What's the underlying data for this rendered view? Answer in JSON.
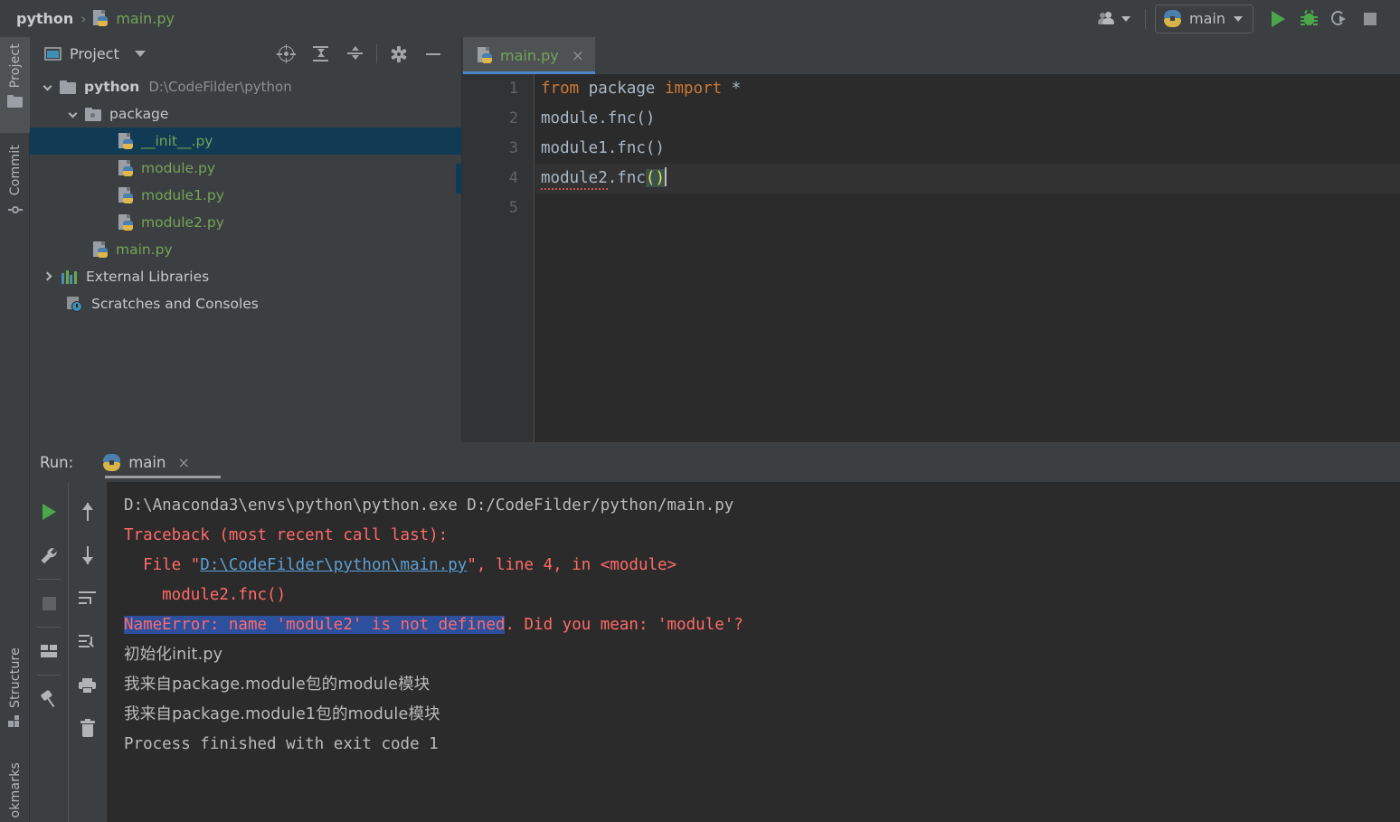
{
  "app": {
    "breadcrumb": {
      "project": "python",
      "separator": "›",
      "file": "main.py",
      "file_icon": "python-file-icon"
    },
    "toolbar": {
      "people_icon": "people-icon",
      "run_config": {
        "name": "main",
        "icon": "python-icon",
        "caret": "caret-down-icon"
      },
      "run_button": "run-icon",
      "debug_button": "debug-icon",
      "coverage_button": "run-with-coverage-icon",
      "stop_button": "stop-icon"
    }
  },
  "left_strip": {
    "tabs": [
      {
        "label": "Project",
        "icon": "folder-icon",
        "active": true
      },
      {
        "label": "Commit",
        "icon": "commit-icon",
        "active": false
      },
      {
        "label": "Structure",
        "icon": "structure-icon",
        "active": false
      },
      {
        "label": "okmarks",
        "icon": "bookmarks-icon",
        "active": false
      }
    ]
  },
  "project_panel": {
    "title": "Project",
    "title_icon": "project-window-icon",
    "dropdown_icon": "chevron-down-icon",
    "tools": [
      {
        "name": "select-opened-file-icon"
      },
      {
        "name": "expand-all-icon"
      },
      {
        "name": "collapse-all-icon"
      },
      {
        "name": "settings-gear-icon"
      },
      {
        "name": "hide-panel-icon"
      }
    ],
    "tree": [
      {
        "indent": 0,
        "arrow": "down",
        "icon": "folder-icon",
        "label": "python",
        "bold": true,
        "path": "D:\\CodeFilder\\python",
        "selected": false
      },
      {
        "indent": 1,
        "arrow": "down",
        "icon": "package-folder-icon",
        "label": "package",
        "bold": false,
        "path": "",
        "selected": false
      },
      {
        "indent": 2,
        "arrow": "none",
        "icon": "python-file-icon",
        "label": "__init__.py",
        "bold": false,
        "path": "",
        "selected": true
      },
      {
        "indent": 2,
        "arrow": "none",
        "icon": "python-file-icon",
        "label": "module.py",
        "bold": false,
        "path": "",
        "selected": false
      },
      {
        "indent": 2,
        "arrow": "none",
        "icon": "python-file-icon",
        "label": "module1.py",
        "bold": false,
        "path": "",
        "selected": false
      },
      {
        "indent": 2,
        "arrow": "none",
        "icon": "python-file-icon",
        "label": "module2.py",
        "bold": false,
        "path": "",
        "selected": false
      },
      {
        "indent": 1,
        "arrow": "none",
        "icon": "python-file-icon",
        "label": "main.py",
        "bold": false,
        "path": "",
        "selected": false
      },
      {
        "indent": 0,
        "arrow": "right",
        "icon": "libraries-icon",
        "label": "External Libraries",
        "bold": false,
        "path": "",
        "selected": false
      },
      {
        "indent": 0,
        "arrow": "none",
        "icon": "scratches-icon",
        "label": "Scratches and Consoles",
        "bold": false,
        "path": "",
        "selected": false
      }
    ]
  },
  "editor": {
    "tab": {
      "label": "main.py",
      "icon": "python-file-icon",
      "close": "×",
      "active": true
    },
    "line_numbers": [
      "1",
      "2",
      "3",
      "4",
      "5"
    ],
    "lines": [
      {
        "n": 1,
        "text": "from package import *"
      },
      {
        "n": 2,
        "text": "module.fnc()"
      },
      {
        "n": 3,
        "text": "module1.fnc()"
      },
      {
        "n": 4,
        "text": "module2.fnc()",
        "current": true,
        "error": true
      },
      {
        "n": 5,
        "text": ""
      }
    ],
    "tokens": {
      "kw_from": "from",
      "mod_package": " package ",
      "kw_import": "import",
      "star": " *",
      "l2_a": "module.fnc()",
      "l3_a": "module1.fnc()",
      "l4_a": "module2",
      "l4_b": ".fnc",
      "l4_c": "()"
    }
  },
  "run_panel": {
    "label": "Run:",
    "tab": {
      "name": "main",
      "icon": "python-icon",
      "close": "×"
    },
    "tools_left": [
      {
        "name": "rerun-icon"
      },
      {
        "name": "settings-wrench-icon"
      },
      {
        "name": "stop-icon"
      },
      {
        "name": "layout-icon"
      },
      {
        "name": "pin-tab-icon"
      }
    ],
    "tools_right": [
      {
        "name": "up-arrow-icon"
      },
      {
        "name": "down-arrow-icon"
      },
      {
        "name": "soft-wrap-icon"
      },
      {
        "name": "scroll-to-end-icon"
      },
      {
        "name": "print-icon"
      },
      {
        "name": "clear-all-icon"
      }
    ],
    "console": {
      "l1": "D:\\Anaconda3\\envs\\python\\python.exe D:/CodeFilder/python/main.py",
      "l2": "Traceback (most recent call last):",
      "l3_pre": "  File \"",
      "l3_link": "D:\\CodeFilder\\python\\main.py",
      "l3_post": "\", line 4, in <module>",
      "l4": "    module2.fnc()",
      "l5_hl": "NameError: name 'module2' is not defined",
      "l5_rest": ". Did you mean: 'module'?",
      "l6": "初始化init.py",
      "l7": "我来自package.module包的module模块",
      "l8": "我来自package.module1包的module模块",
      "l9": "",
      "l10": "Process finished with exit code 1"
    }
  },
  "colors": {
    "chrome": "#3c3f41",
    "editor_bg": "#2b2b2b",
    "accent_blue": "#4a88c7",
    "tree_selection": "#113a54",
    "console_selection": "#2c4f9e",
    "error_red": "#ff6b68",
    "python_green": "#73a457",
    "keyword_orange": "#cc7832",
    "link_blue": "#5c9fd6"
  }
}
